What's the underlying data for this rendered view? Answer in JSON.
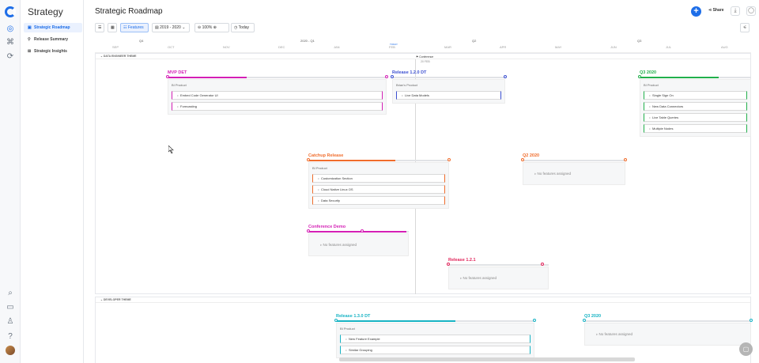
{
  "app": {
    "section_title": "Strategy",
    "page_title": "Strategic Roadmap"
  },
  "sidebar": {
    "items": [
      {
        "label": "Strategic Roadmap",
        "icon": "roadmap-icon",
        "active": true
      },
      {
        "label": "Release Summary",
        "icon": "release-icon",
        "active": false
      },
      {
        "label": "Strategic Insights",
        "icon": "insights-icon",
        "active": false
      }
    ]
  },
  "header": {
    "share_label": "Share"
  },
  "toolbar": {
    "features_label": "Features",
    "date_range": "2019 - 2020",
    "zoom": "100%",
    "today_label": "Today"
  },
  "timeline": {
    "quarters": [
      "Q4",
      "2020 - Q1",
      "Q2",
      "Q3"
    ],
    "months": [
      "SEP",
      "OCT",
      "NOV",
      "DEC",
      "JAN",
      "FEB",
      "MAR",
      "APR",
      "MAY",
      "JUN",
      "JUL",
      "AUG"
    ],
    "today_marker": "TODAY"
  },
  "themes": [
    {
      "name": "DATA ENGINEER THEME"
    },
    {
      "name": "DEVELOPER THEME"
    }
  ],
  "milestone": {
    "name": "Conference",
    "date": "20 FEB"
  },
  "releases": [
    {
      "name": "MVP DET",
      "color": "#d41fb5",
      "progress": 0.36,
      "product": "BI Product",
      "features": [
        "Embed Code Generator UI",
        "Forecasting"
      ]
    },
    {
      "name": "Release 1.2.0 DT",
      "color": "#3b4fd1",
      "progress": 0.0,
      "product": "Brian's Product",
      "features": [
        "Live Data Models"
      ]
    },
    {
      "name": "Q3 2020",
      "color": "#21b04b",
      "progress": 0.71,
      "product": "BI Product",
      "features": [
        "Single Sign On",
        "New Data Connectors",
        "Live Table Queries",
        "Multiple Nodes"
      ]
    },
    {
      "name": "Catchup Release",
      "color": "#f06c2b",
      "progress": 0.62,
      "product": "BI Product",
      "features": [
        "Customization Section",
        "Cloud Native Linux OS",
        "Data Security"
      ]
    },
    {
      "name": "Q2 2020",
      "color": "#f06c2b",
      "progress": 0.0,
      "no_features": "No features assigned"
    },
    {
      "name": "Conference Demo",
      "color": "#d41fb5",
      "progress": 0.98,
      "no_features": "No features assigned"
    },
    {
      "name": "Release 1.2.1",
      "color": "#e1245a",
      "progress": 0.0,
      "no_features": "No features assigned"
    },
    {
      "name": "Release 1.3.0 DT",
      "color": "#17b3c4",
      "progress": 0.6,
      "product": "BI Product",
      "features": [
        "New Feature Example",
        "Similar Grouping"
      ]
    },
    {
      "name": "Q3 2020",
      "color": "#17b3c4",
      "progress": 0.0,
      "no_features": "No features assigned"
    }
  ]
}
